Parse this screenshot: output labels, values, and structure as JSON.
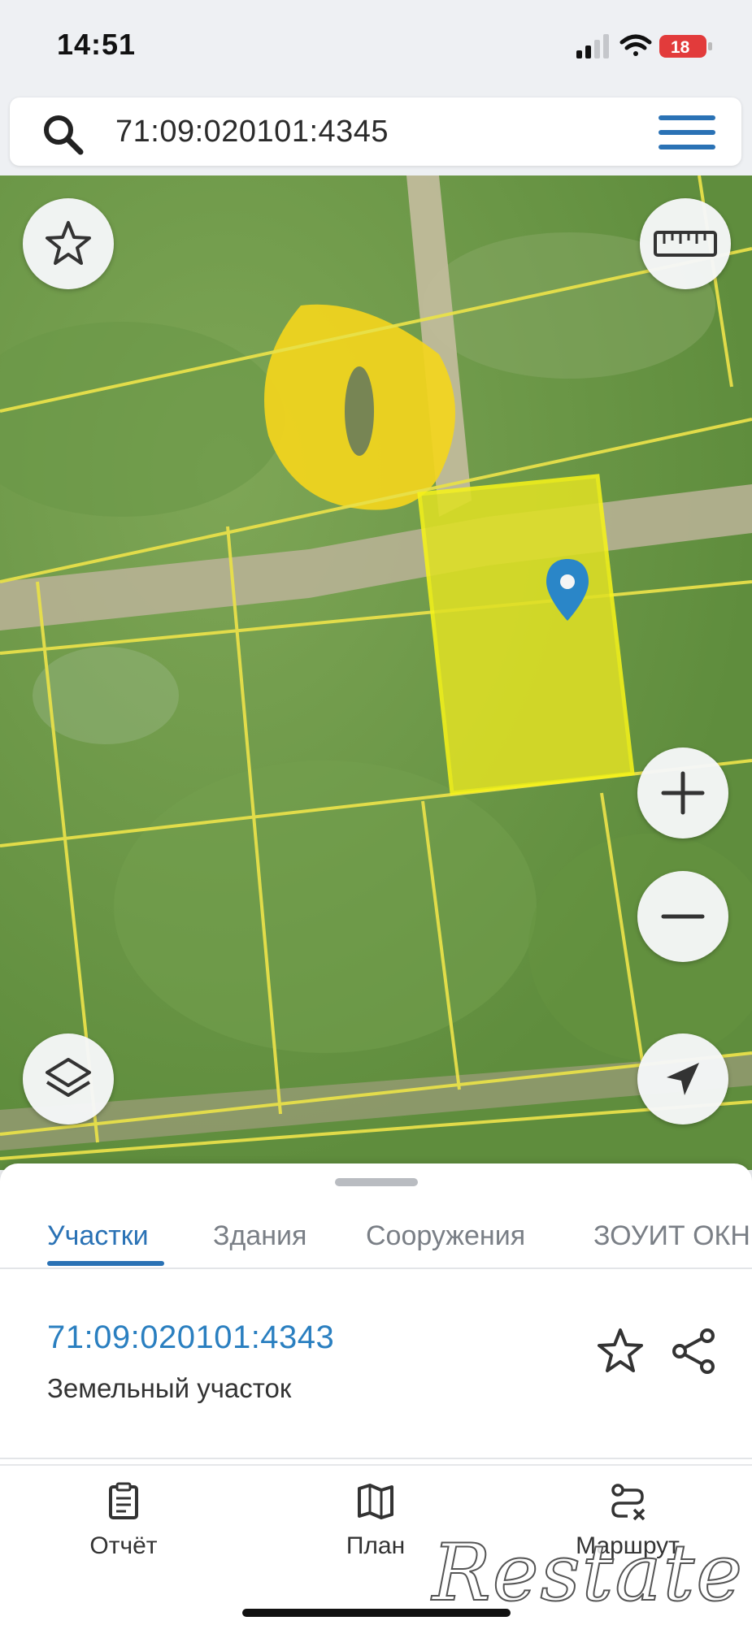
{
  "status_bar": {
    "time": "14:51",
    "battery": "18"
  },
  "search": {
    "value": "71:09:020101:4345"
  },
  "map": {
    "buttons": {
      "favorite": "star-icon",
      "ruler": "ruler-icon",
      "zoom_in": "plus-icon",
      "zoom_out": "minus-icon",
      "layers": "layers-icon",
      "locate": "navigation-arrow-icon"
    },
    "colors": {
      "parcel_line": "#e8e04a",
      "selected_parcel": "#dfe025",
      "marker": "#2a86c8"
    }
  },
  "sheet": {
    "tabs": [
      {
        "label": "Участки",
        "active": true
      },
      {
        "label": "Здания",
        "active": false
      },
      {
        "label": "Сооружения",
        "active": false
      },
      {
        "label": "ЗОУИТ ОКН",
        "active": false
      }
    ],
    "item": {
      "number": "71:09:020101:4343",
      "type": "Земельный участок"
    }
  },
  "nav": {
    "items": [
      {
        "label": "Отчёт",
        "icon": "report-clipboard-icon"
      },
      {
        "label": "План",
        "icon": "map-plan-icon"
      },
      {
        "label": "Маршрут",
        "icon": "route-icon"
      }
    ]
  },
  "watermark": "Restate",
  "colors": {
    "accent": "#2a72b5",
    "link": "#2a7fc0"
  }
}
